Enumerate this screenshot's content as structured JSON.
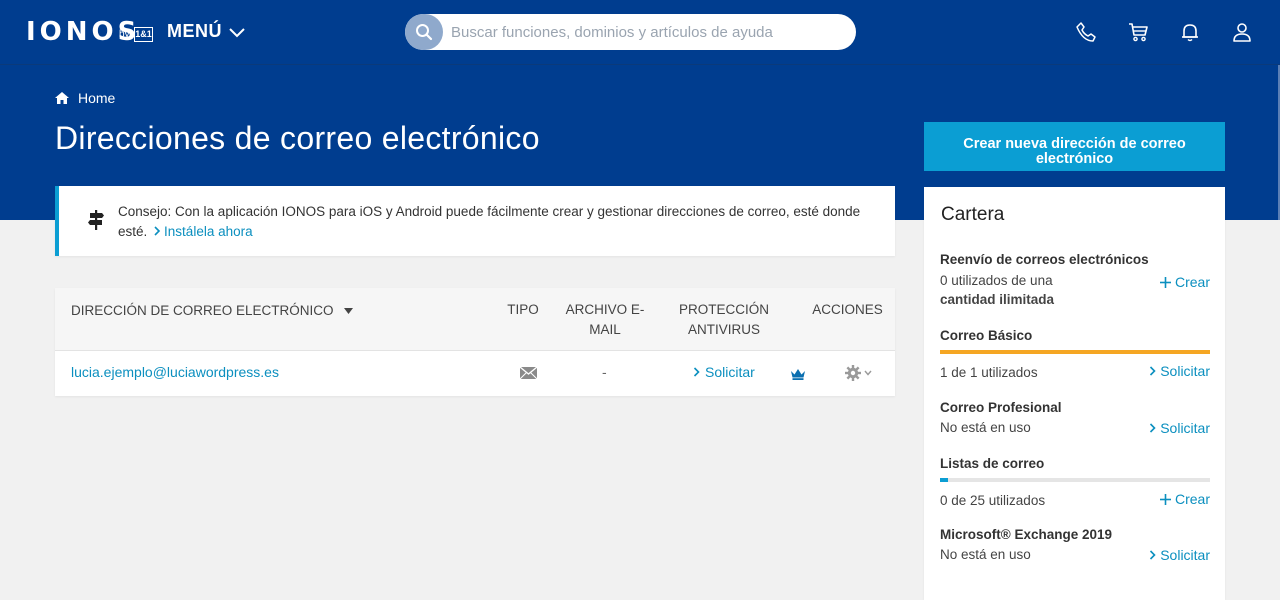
{
  "header": {
    "logo": "IONOS",
    "logo_by": "by",
    "logo_brand": "1&1",
    "menu_label": "MENÚ",
    "search_placeholder": "Buscar funciones, dominios y artículos de ayuda",
    "icons": [
      "phone-icon",
      "cart-icon",
      "bell-icon",
      "user-icon"
    ]
  },
  "breadcrumb": {
    "home": "Home"
  },
  "page_title": "Direcciones de correo electrónico",
  "create_button": "Crear nueva dirección de correo electrónico",
  "tip": {
    "text": "Consejo: Con la aplicación IONOS para iOS y Android puede fácilmente crear y gestionar direcciones de correo, esté donde esté.",
    "link": "Instálela ahora"
  },
  "table": {
    "headers": {
      "email": "DIRECCIÓN DE CORREO ELECTRÓNICO",
      "type": "TIPO",
      "archive": "ARCHIVO E-MAIL",
      "antivirus_line1": "PROTECCIÓN",
      "antivirus_line2": "ANTIVIRUS",
      "actions": "ACCIONES"
    },
    "rows": [
      {
        "email": "lucia.ejemplo@luciawordpress.es",
        "type_icon": "mail-icon",
        "archive": "-",
        "antivirus": "Solicitar"
      }
    ]
  },
  "cartera": {
    "title": "Cartera",
    "items": [
      {
        "name": "Reenvío de correos electrónicos",
        "status_line1": "0 utilizados de una",
        "status_line2": "cantidad ilimitada",
        "action": "Crear"
      },
      {
        "name": "Correo Básico",
        "usage_fraction": 1.0,
        "bar_color": "#f5a623",
        "status": "1 de 1 utilizados",
        "action": "Solicitar"
      },
      {
        "name": "Correo Profesional",
        "status": "No está en uso",
        "action": "Solicitar"
      },
      {
        "name": "Listas de correo",
        "usage_fraction": 0.0,
        "bar_color": "#0b9ed3",
        "status": "0 de 25 utilizados",
        "action": "Crear"
      },
      {
        "name": "Microsoft® Exchange 2019",
        "status": "No está en uso",
        "action": "Solicitar"
      }
    ]
  },
  "colors": {
    "brand_blue": "#003d8f",
    "accent": "#0b9ed3",
    "link": "#0b8fbf"
  }
}
